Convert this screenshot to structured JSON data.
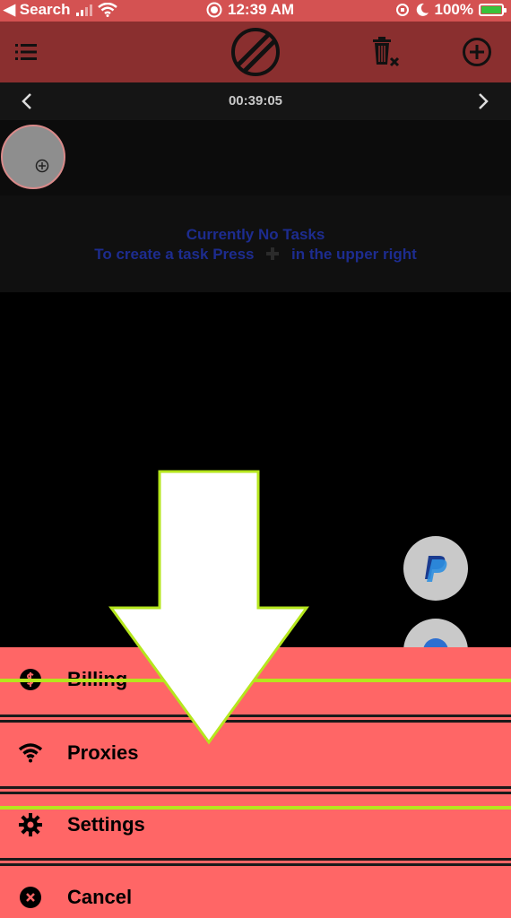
{
  "status_bar": {
    "back_label": "◀ Search",
    "time": "12:39 AM",
    "battery": "100%"
  },
  "header": {
    "menu_icon": "list-icon",
    "logo_icon": "slashed-circle-logo",
    "delete_icon": "trash-x-icon",
    "add_icon": "plus-circle-icon"
  },
  "date_nav": {
    "time": "00:39:05"
  },
  "empty_state": {
    "line1": "Currently No Tasks",
    "line2_before": "To create a task Press",
    "line2_after": "in the upper right"
  },
  "action_sheet": {
    "items": [
      {
        "label": "Billing",
        "icon": "dollar-circle-icon"
      },
      {
        "label": "Proxies",
        "icon": "wifi-icon"
      },
      {
        "label": "Settings",
        "icon": "gear-icon"
      },
      {
        "label": "Cancel",
        "icon": "x-circle-icon"
      }
    ]
  },
  "colors": {
    "status_bar": "#d45252",
    "header": "#8a2f2f",
    "sheet": "#ff6666",
    "highlight": "#b5e61d",
    "empty_text": "#1d2c8f"
  }
}
